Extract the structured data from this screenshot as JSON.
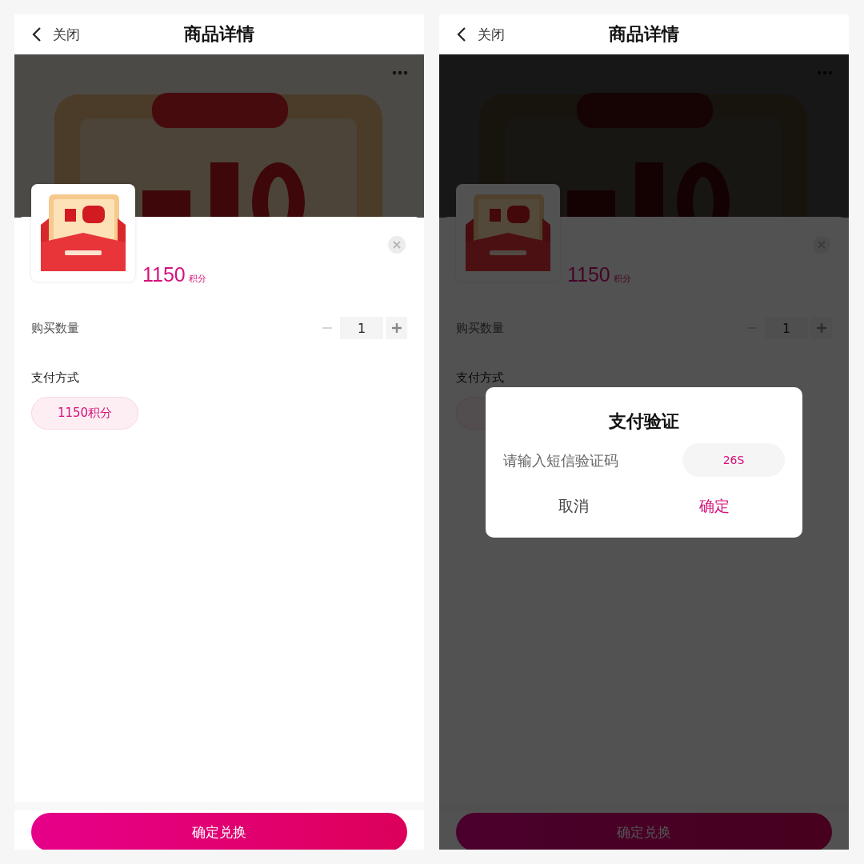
{
  "panels": [
    {
      "header": {
        "back_label": "关闭",
        "title": "商品详情"
      },
      "price": {
        "amount": "1150",
        "unit": "积分"
      },
      "quantity": {
        "label": "购买数量",
        "value": "1",
        "decrease_disabled": true
      },
      "payment": {
        "label": "支付方式",
        "options": [
          {
            "label": "1150积分",
            "selected": true
          }
        ]
      },
      "submit": {
        "label": "确定兑换"
      }
    },
    {
      "header": {
        "back_label": "关闭",
        "title": "商品详情"
      },
      "price": {
        "amount": "1150",
        "unit": "积分"
      },
      "quantity": {
        "label": "购买数量",
        "value": "1",
        "decrease_disabled": true
      },
      "payment": {
        "label": "支付方式",
        "options": [
          {
            "selected": true
          }
        ]
      },
      "submit": {
        "label": "确定兑换"
      },
      "dialog": {
        "title": "支付验证",
        "placeholder": "请输入短信验证码",
        "countdown": "26S",
        "cancel": "取消",
        "confirm": "确定"
      }
    }
  ]
}
